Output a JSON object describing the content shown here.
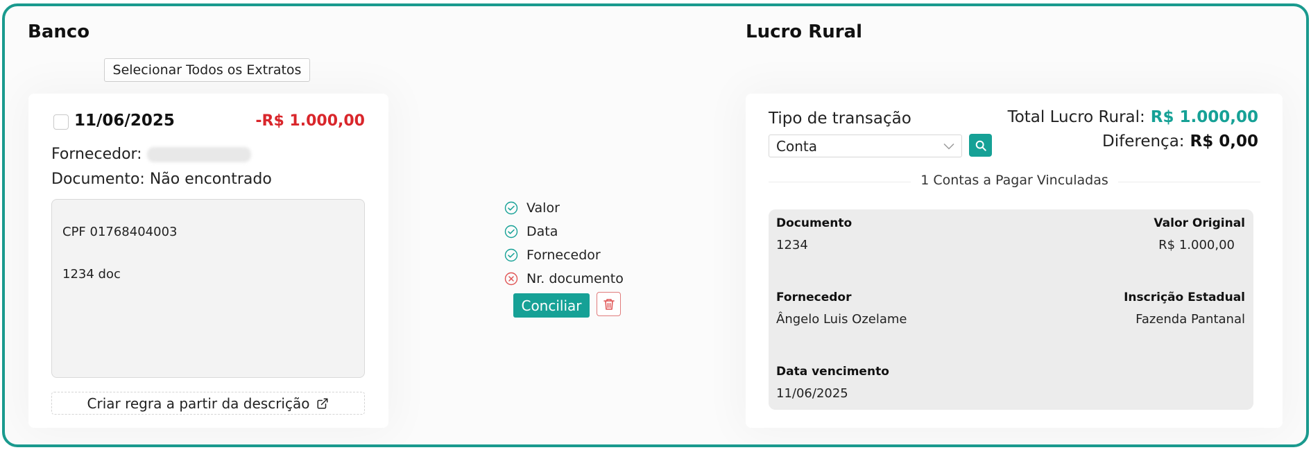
{
  "bank": {
    "title": "Banco",
    "select_all_label": "Selecionar Todos os Extratos",
    "statement": {
      "date": "11/06/2025",
      "amount": "-R$ 1.000,00",
      "supplier_label": "Fornecedor:",
      "document_line": "Documento: Não encontrado",
      "description_lines": [
        "CPF 01768404003",
        "1234 doc"
      ],
      "rule_button_label": "Criar regra a partir da descrição"
    }
  },
  "match": {
    "criteria": [
      {
        "label": "Valor",
        "status": "ok"
      },
      {
        "label": "Data",
        "status": "ok"
      },
      {
        "label": "Fornecedor",
        "status": "ok"
      },
      {
        "label": "Nr. documento",
        "status": "fail"
      }
    ],
    "conciliar_label": "Conciliar"
  },
  "lucro": {
    "title": "Lucro Rural",
    "transaction_type_label": "Tipo de transação",
    "transaction_type_value": "Conta",
    "total_label": "Total Lucro Rural:",
    "total_value": "R$ 1.000,00",
    "diff_label": "Diferença:",
    "diff_value": "R$ 0,00",
    "linked_text": "1 Contas a Pagar Vinculadas",
    "account": {
      "documento_label": "Documento",
      "documento_value": "1234",
      "valor_label": "Valor Original",
      "valor_value": "R$ 1.000,00",
      "fornecedor_label": "Fornecedor",
      "fornecedor_value": "Ângelo Luis Ozelame",
      "inscricao_label": "Inscrição Estadual",
      "inscricao_value": "Fazenda Pantanal",
      "vencimento_label": "Data vencimento",
      "vencimento_value": "11/06/2025"
    }
  },
  "colors": {
    "accent": "#16a196",
    "border": "#1a9a8e",
    "negative": "#d9262b",
    "fail": "#e05555"
  },
  "icons": {
    "ok": "check-circle-icon",
    "fail": "x-circle-icon",
    "external": "external-link-icon",
    "trash": "trash-icon",
    "search": "search-icon",
    "chevron": "chevron-down-icon"
  }
}
